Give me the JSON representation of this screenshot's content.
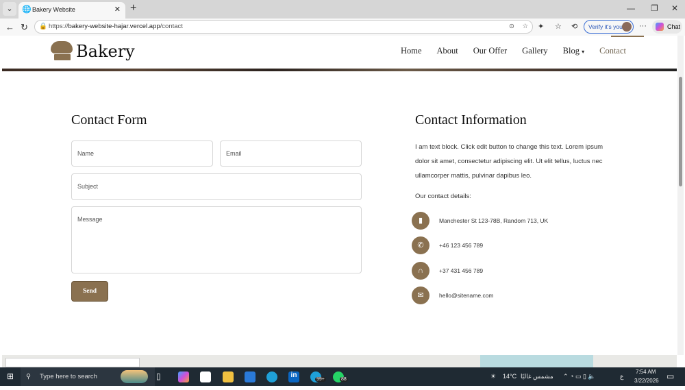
{
  "browser": {
    "tab_title": "Bakery Website",
    "url_prefix": "https://",
    "url_host": "bakery-website-hajar.vercel.app",
    "url_path": "/contact",
    "verify_label": "Verify it's you",
    "chat_label": "Chat"
  },
  "site": {
    "logo_text": "Bakery",
    "nav": [
      {
        "label": "Home"
      },
      {
        "label": "About"
      },
      {
        "label": "Our Offer"
      },
      {
        "label": "Gallery"
      },
      {
        "label": "Blog"
      },
      {
        "label": "Contact"
      }
    ]
  },
  "form": {
    "title": "Contact Form",
    "name_placeholder": "Name",
    "email_placeholder": "Email",
    "subject_placeholder": "Subject",
    "message_placeholder": "Message",
    "send_label": "Send"
  },
  "info": {
    "title": "Contact Information",
    "paragraph": "I am text block. Click edit button to change this text. Lorem ipsum dolor sit amet, consectetur adipiscing elit. Ut elit tellus, luctus nec ullamcorper mattis, pulvinar dapibus leo.",
    "details_label": "Our contact details:",
    "items": [
      {
        "icon": "map-icon",
        "text": "Manchester St 123-78B, Random 713, UK"
      },
      {
        "icon": "phone-icon",
        "text": "+46 123 456 789"
      },
      {
        "icon": "headphones-icon",
        "text": "+37 431 456 789"
      },
      {
        "icon": "envelope-icon",
        "text": "hello@sitename.com"
      }
    ]
  },
  "taskbar": {
    "search_placeholder": "Type here to search",
    "badge_edge": "99+",
    "badge_whatsapp": "88",
    "weather": "14°C",
    "weather_text": "مشمس غالبًا",
    "lang": "ع",
    "time": "7:54 AM",
    "date": "3/22/2026"
  }
}
